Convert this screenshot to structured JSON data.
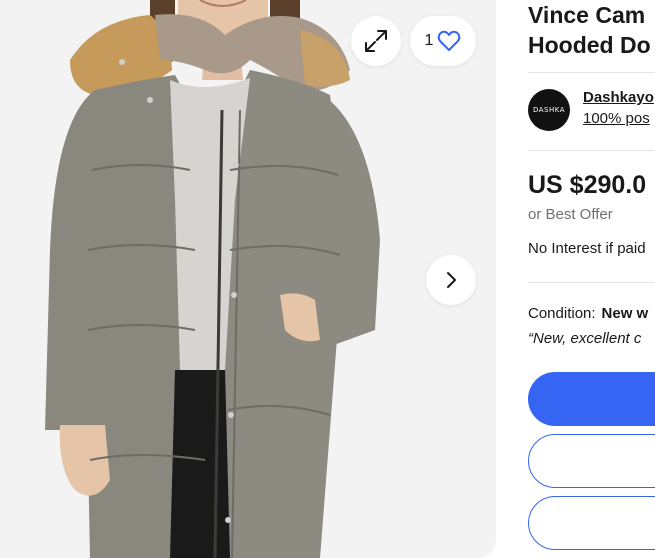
{
  "gallery": {
    "watch_count": "1"
  },
  "listing": {
    "title_line1": "Vince Cam",
    "title_line2": "Hooded Do"
  },
  "seller": {
    "logo_text": "DASHKA",
    "name": "Dashkayo",
    "feedback": "100% pos"
  },
  "pricing": {
    "price": "US $290.0",
    "best_offer": "or Best Offer",
    "financing": "No Interest if paid"
  },
  "condition": {
    "label": "Condition:",
    "value": "New w",
    "note": "“New, excellent c"
  },
  "colors": {
    "accent": "#3665f3",
    "coat": "#8a877e",
    "fur": "#c59a5a"
  }
}
